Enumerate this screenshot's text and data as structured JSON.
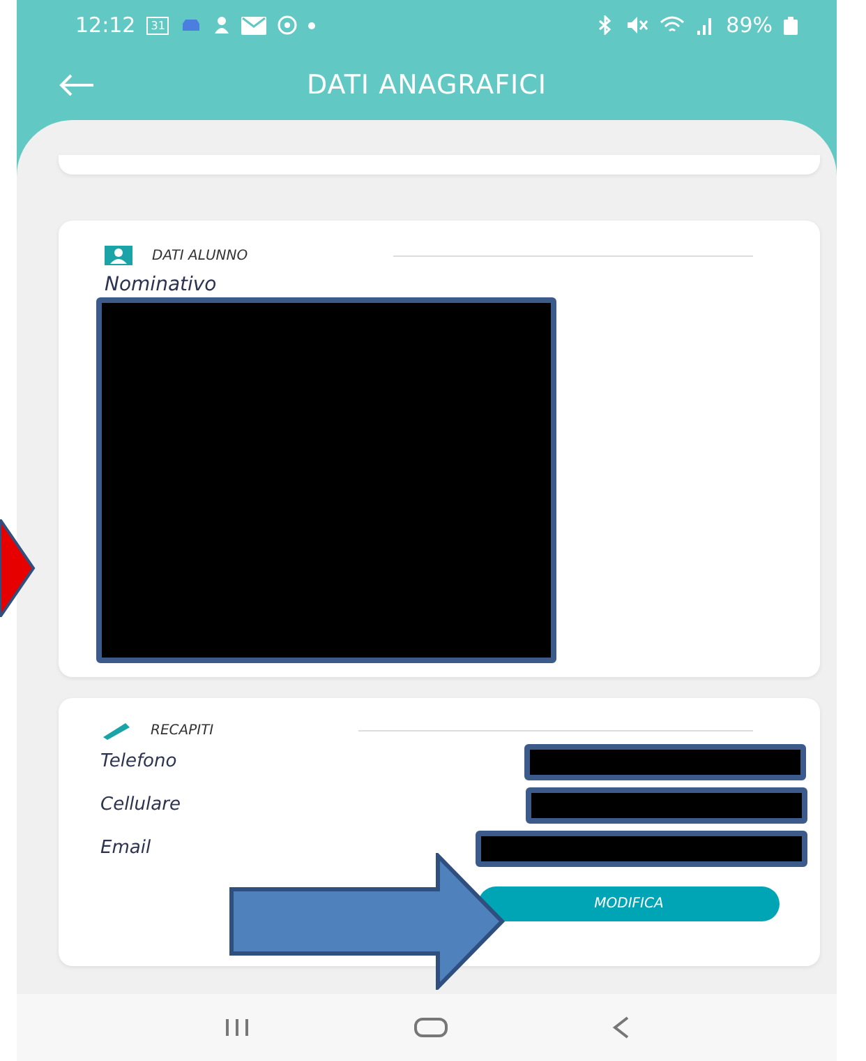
{
  "status_bar": {
    "time": "12:12",
    "calendar_day": "31",
    "battery": "89%"
  },
  "header": {
    "title": "DATI ANAGRAFICI"
  },
  "student_card": {
    "title": "DATI ALUNNO",
    "field_label": "Nominativo"
  },
  "contacts_card": {
    "title": "RECAPITI",
    "fields": [
      {
        "label": "Telefono"
      },
      {
        "label": "Cellulare"
      },
      {
        "label": "Email"
      }
    ],
    "button": "MODIFICA"
  }
}
